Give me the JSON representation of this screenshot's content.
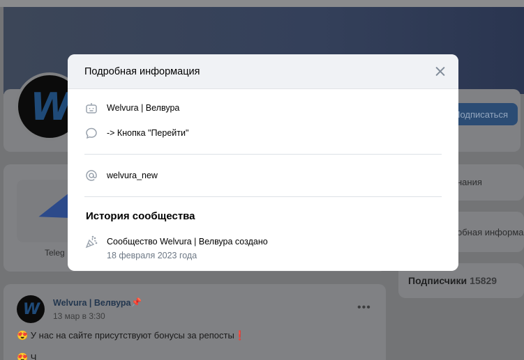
{
  "background": {
    "subscribe_label": "Подписаться",
    "side_item_1": "нания",
    "side_item_2": "обная информа",
    "telegram_label": "Teleg",
    "avatar_letter": "W",
    "post": {
      "author": "Welvura | Велвура",
      "date": "13 мар в 3:30",
      "text": "😍 У нас на сайте присутствуют бонусы за репосты❗",
      "text2": "😍 Ч"
    },
    "subscribers": {
      "label": "Подписчики",
      "count": "15829"
    }
  },
  "modal": {
    "title": "Подробная информация",
    "rows": [
      {
        "icon": "bot-icon",
        "text": "Welvura | Велвура"
      },
      {
        "icon": "message-icon",
        "text": "-> Кнопка \"Перейти\""
      },
      {
        "icon": "at-icon",
        "text": "welvura_new"
      }
    ],
    "history": {
      "title": "История сообщества",
      "icon": "party-popper-icon",
      "line1": "Сообщество Welvura | Велвура создано",
      "line2": "18 февраля 2023 года"
    }
  },
  "colors": {
    "accent": "#2688eb",
    "secondary_text": "#6d7885",
    "icon": "#99a2ad",
    "header_bg": "#f0f2f5"
  }
}
